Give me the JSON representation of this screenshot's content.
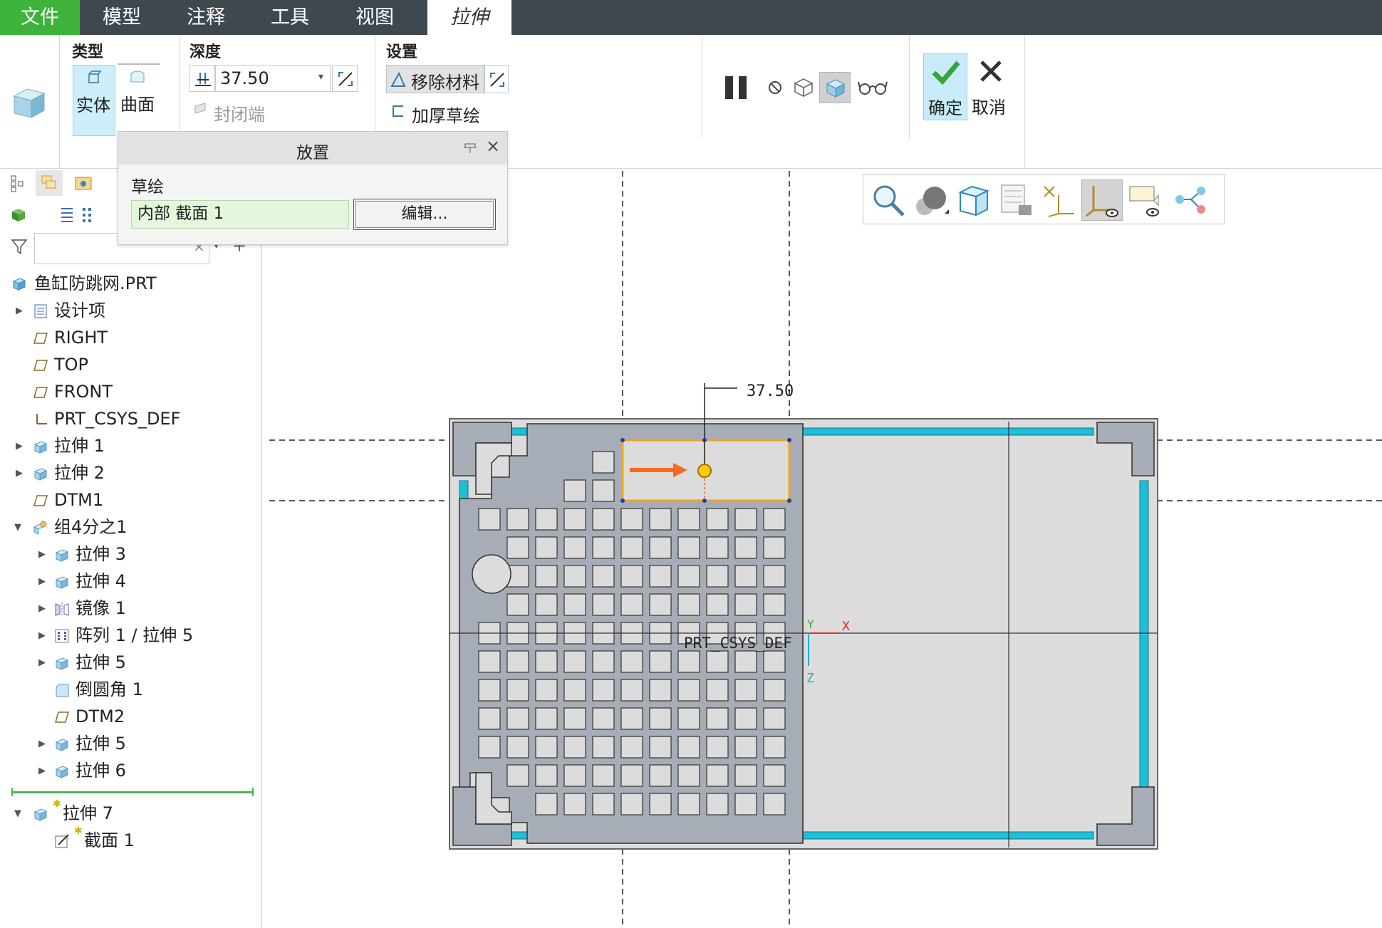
{
  "menubar": {
    "tabs": [
      {
        "label": "文件",
        "active": false
      },
      {
        "label": "模型",
        "active": false
      },
      {
        "label": "注释",
        "active": false
      },
      {
        "label": "工具",
        "active": false
      },
      {
        "label": "视图",
        "active": false
      },
      {
        "label": "拉伸",
        "active": true
      }
    ]
  },
  "ribbon": {
    "type_group": {
      "title": "类型",
      "solid": "实体",
      "surface": "曲面"
    },
    "depth_group": {
      "title": "深度",
      "value": "37.50",
      "cap_ends": "封闭端"
    },
    "settings_group": {
      "title": "设置",
      "remove_material": "移除材料",
      "thicken_sketch": "加厚草绘"
    },
    "confirm": "确定",
    "cancel": "取消"
  },
  "placement_panel": {
    "title": "放置",
    "sketch_label": "草绘",
    "section_value": "内部 截面 1",
    "edit_button": "编辑..."
  },
  "model_tree": {
    "items": [
      {
        "label": "鱼缸防跳网.PRT",
        "icon": "part-icon"
      },
      {
        "label": "设计项",
        "icon": "design-items-icon"
      },
      {
        "label": "RIGHT",
        "icon": "datum-plane-icon"
      },
      {
        "label": "TOP",
        "icon": "datum-plane-icon"
      },
      {
        "label": "FRONT",
        "icon": "datum-plane-icon"
      },
      {
        "label": "PRT_CSYS_DEF",
        "icon": "csys-icon"
      },
      {
        "label": "拉伸 1",
        "icon": "extrude-icon"
      },
      {
        "label": "拉伸 2",
        "icon": "extrude-icon"
      },
      {
        "label": "DTM1",
        "icon": "datum-plane-icon"
      },
      {
        "label": "组4分之1",
        "icon": "group-icon"
      },
      {
        "label": "拉伸 3",
        "icon": "extrude-icon"
      },
      {
        "label": "拉伸 4",
        "icon": "extrude-icon"
      },
      {
        "label": "镜像 1",
        "icon": "mirror-icon"
      },
      {
        "label": "阵列 1 / 拉伸 5",
        "icon": "pattern-icon"
      },
      {
        "label": "拉伸 5",
        "icon": "extrude-icon"
      },
      {
        "label": "倒圆角 1",
        "icon": "round-icon"
      },
      {
        "label": "DTM2",
        "icon": "datum-plane-icon"
      },
      {
        "label": "拉伸 5",
        "icon": "extrude-icon"
      },
      {
        "label": "拉伸 6",
        "icon": "extrude-icon"
      },
      {
        "label": "拉伸 7",
        "icon": "extrude-icon"
      },
      {
        "label": "截面 1",
        "icon": "sketch-icon"
      }
    ]
  },
  "graphics": {
    "dimension": "37.50",
    "csys_label": "PRT_CSYS_DEF",
    "axis_x": "X",
    "axis_y": "Y",
    "axis_z": "Z"
  },
  "colors": {
    "menubar": "#40484f",
    "file_tab": "#3eb33c",
    "active_tab": "#ffffff",
    "model_fill": "#a7adb6",
    "cyan_edge": "#1cc0d8",
    "sketch_orange": "#f2a31f",
    "arrow_orange": "#f56a1e"
  }
}
